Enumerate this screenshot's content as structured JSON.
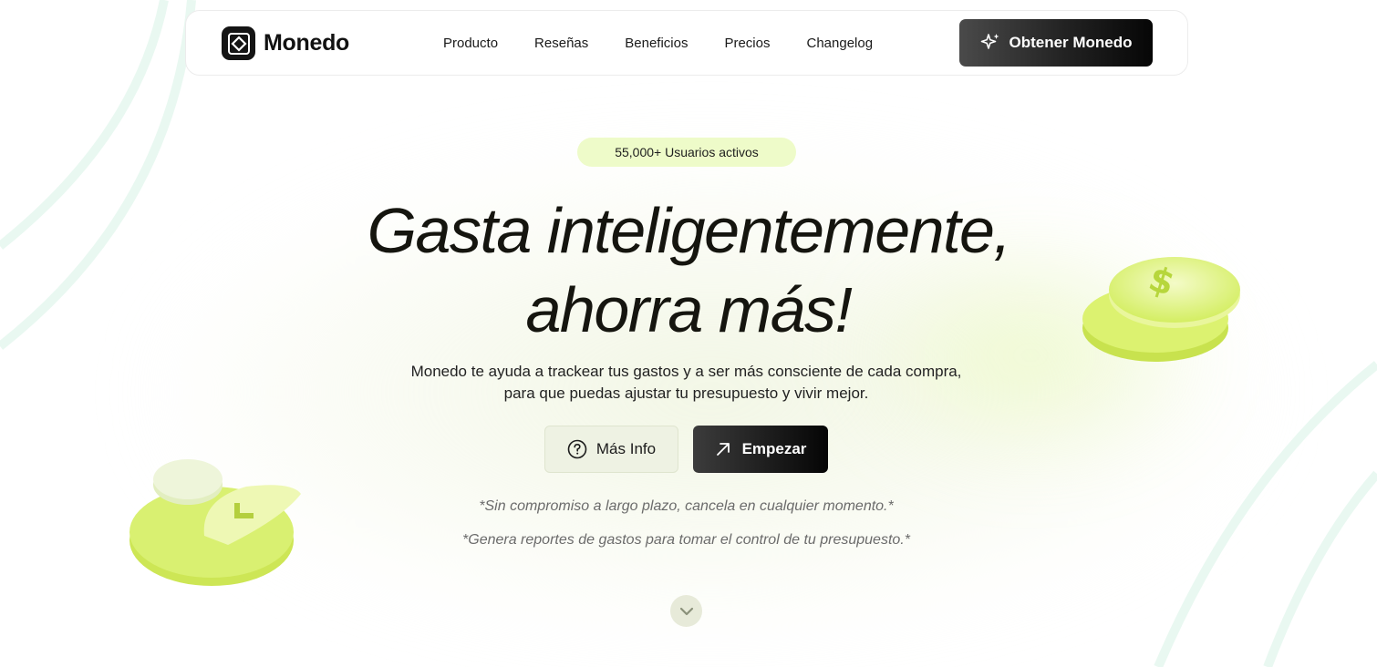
{
  "nav": {
    "brand": "Monedo",
    "links": [
      "Producto",
      "Reseñas",
      "Beneficios",
      "Precios",
      "Changelog"
    ],
    "cta_label": "Obtener Monedo",
    "cta_icon": "sparkles-icon"
  },
  "hero": {
    "badge": "55,000+ Usuarios activos",
    "headline_line1": "Gasta inteligentemente,",
    "headline_line2": "ahorra más!",
    "subtext_line1": "Monedo te ayuda a trackear tus gastos y a ser más consciente de cada compra,",
    "subtext_line2": "para que puedas ajustar tu presupuesto y vivir mejor.",
    "info_button": "Más Info",
    "start_button": "Empezar",
    "note1": "*Sin compromiso a largo plazo, cancela en cualquier momento.*",
    "note2": "*Genera reportes de gastos para tomar el control de tu presupuesto.*"
  },
  "colors": {
    "accent_lime": "#d6f06a",
    "badge_bg": "#eefbc9",
    "dark": "#141414"
  }
}
